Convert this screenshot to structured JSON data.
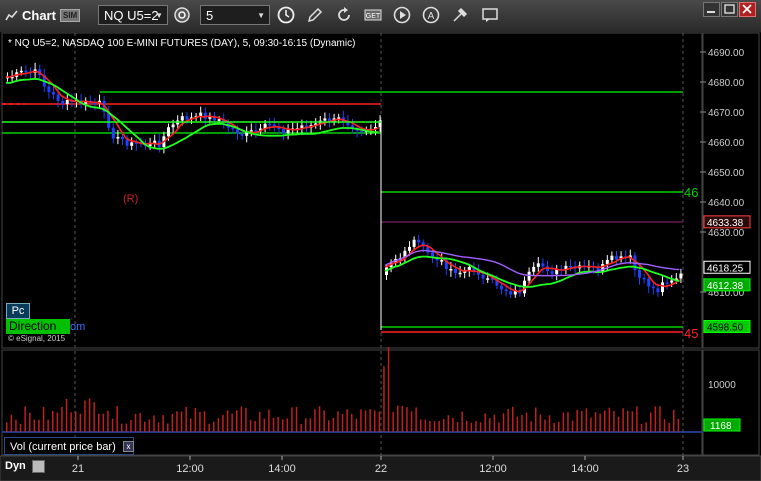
{
  "window": {
    "title": "Chart",
    "sim_badge": "SIM"
  },
  "toolbar": {
    "symbol_value": "NQ U5=2",
    "interval_value": "5",
    "icons": [
      "link-icon",
      "clock-icon",
      "pencil-icon",
      "refresh-icon",
      "get-icon",
      "play-icon",
      "cursor-icon",
      "tools-icon",
      "comment-icon"
    ]
  },
  "chart": {
    "info": "* NQ U5=2, NASDAQ 100 E-MINI FUTURES (DAY), 5, 09:30-16:15 (Dynamic)",
    "price_axis_ticks": [
      "4690.00",
      "4680.00",
      "4670.00",
      "4660.00",
      "4650.00",
      "4640.00",
      "4630.00",
      "4610.00"
    ],
    "price_tags": [
      {
        "label": "4633.38",
        "bg": "#2a0a0a",
        "fg": "#fff",
        "border": "#ff4040"
      },
      {
        "label": "4618.25",
        "bg": "#000",
        "fg": "#fff",
        "border": "#fff"
      },
      {
        "label": "4612.38",
        "bg": "#00aa00",
        "fg": "#fff",
        "border": "#00ff00"
      },
      {
        "label": "4598.50",
        "bg": "#00cc00",
        "fg": "#000",
        "border": "#00ff00"
      }
    ],
    "level_labels": {
      "upper": "46",
      "lower": "45"
    },
    "marker_label": "(R)",
    "pc_label": "Pc",
    "direction_label": "Direction",
    "direction_suffix": "om",
    "copyright": "© eSignal, 2015",
    "colors": {
      "up": "#ffffff",
      "down": "#1e40ff",
      "ma_red": "#ff2020",
      "ma_green": "#20ff20",
      "ma_purple": "#a060ff",
      "level_green": "#00d000",
      "level_red": "#ff2020"
    }
  },
  "volume": {
    "axis_ticks": [
      "10000"
    ],
    "current_tag": "1168",
    "label": "Vol (current price bar)"
  },
  "time_axis": {
    "labels": [
      "21",
      "12:00",
      "14:00",
      "22",
      "12:00",
      "14:00",
      "23"
    ],
    "dyn_label": "Dyn"
  }
}
